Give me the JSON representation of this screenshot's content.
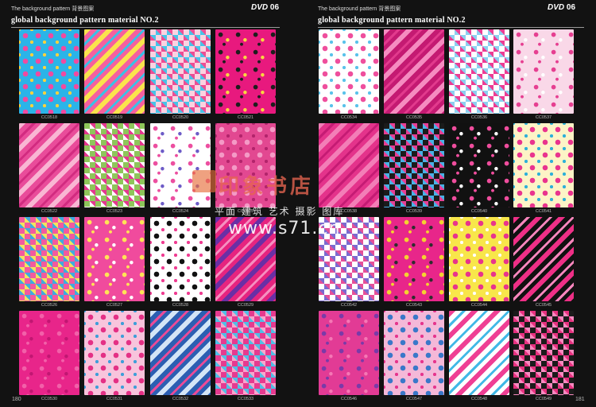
{
  "left_page": {
    "header": "The background pattern 背景图案",
    "dvd_label": "DVD",
    "dvd_number": "06",
    "title": "global background pattern material NO.2",
    "page_number": "180",
    "tiles": [
      {
        "code": "CC0518",
        "colors": [
          "#2bb4e8",
          "#f04aa0",
          "#ffd23c"
        ]
      },
      {
        "code": "CC0519",
        "colors": [
          "#f5609e",
          "#fbe34c",
          "#3ac0e6"
        ]
      },
      {
        "code": "CC0520",
        "colors": [
          "#fbd2e0",
          "#ee4d93",
          "#46c4e8"
        ]
      },
      {
        "code": "CC0521",
        "colors": [
          "#e8197e",
          "#1d1d1d",
          "#f8d840"
        ]
      },
      {
        "code": "CC0522",
        "colors": [
          "#e94c9a",
          "#f9b6d3",
          "#d22b80"
        ]
      },
      {
        "code": "CC0523",
        "colors": [
          "#8ec65a",
          "#e4378f",
          "#ffffff"
        ]
      },
      {
        "code": "CC0524",
        "colors": [
          "#ffffff",
          "#ec4fa0",
          "#6d5bc7"
        ]
      },
      {
        "code": "CC0525",
        "colors": [
          "#e24891",
          "#f49ac6",
          "#b3246c"
        ]
      },
      {
        "code": "CC0526",
        "colors": [
          "#f25a9f",
          "#3fa9e0",
          "#f4e25e"
        ]
      },
      {
        "code": "CC0527",
        "colors": [
          "#f04b9d",
          "#ffe455",
          "#ffffff"
        ]
      },
      {
        "code": "CC0528",
        "colors": [
          "#ffffff",
          "#111111",
          "#ef3d92"
        ]
      },
      {
        "code": "CC0529",
        "colors": [
          "#e6247f",
          "#6a2fa5",
          "#f590c0"
        ]
      },
      {
        "code": "CC0530",
        "colors": [
          "#e8258a",
          "#f260a9",
          "#c11672"
        ]
      },
      {
        "code": "CC0531",
        "colors": [
          "#f8c4dc",
          "#e43085",
          "#3f9fd8"
        ]
      },
      {
        "code": "CC0532",
        "colors": [
          "#2c5fb2",
          "#d4e5f6",
          "#ec4a97"
        ]
      },
      {
        "code": "CC0533",
        "colors": [
          "#e63a8f",
          "#4fbfe6",
          "#f7a6cc"
        ]
      }
    ]
  },
  "right_page": {
    "header": "The background pattern 背景图案",
    "dvd_label": "DVD",
    "dvd_number": "06",
    "title": "global background pattern material NO.2",
    "page_number": "181",
    "tiles": [
      {
        "code": "CC0534",
        "colors": [
          "#ffffff",
          "#ef4f9d",
          "#5bc3ea"
        ]
      },
      {
        "code": "CC0535",
        "colors": [
          "#c41a72",
          "#f58cc0",
          "#e23a8d"
        ]
      },
      {
        "code": "CC0536",
        "colors": [
          "#ffffff",
          "#ed3c93",
          "#8bd1f0"
        ]
      },
      {
        "code": "CC0537",
        "colors": [
          "#f9d8e8",
          "#e63f91",
          "#ffffff"
        ]
      },
      {
        "code": "CC0538",
        "colors": [
          "#e4338b",
          "#f37eb7",
          "#c51b74"
        ]
      },
      {
        "code": "CC0539",
        "colors": [
          "#1b1b1b",
          "#e83e93",
          "#47b2e6"
        ]
      },
      {
        "code": "CC0540",
        "colors": [
          "#111111",
          "#ef4d9d",
          "#ffffff"
        ]
      },
      {
        "code": "CC0541",
        "colors": [
          "#fdf4c6",
          "#e9348e",
          "#2fb1d8"
        ]
      },
      {
        "code": "CC0542",
        "colors": [
          "#ffffff",
          "#e65098",
          "#7a6bd0"
        ]
      },
      {
        "code": "CC0543",
        "colors": [
          "#e8268a",
          "#f4d230",
          "#2d2d2d"
        ]
      },
      {
        "code": "CC0544",
        "colors": [
          "#f8e64a",
          "#e8348c",
          "#ffffff"
        ]
      },
      {
        "code": "CC0545",
        "colors": [
          "#111111",
          "#ee2f86",
          "#f886bd"
        ]
      },
      {
        "code": "CC0546",
        "colors": [
          "#e23b95",
          "#7a3aa8",
          "#f577b5"
        ]
      },
      {
        "code": "CC0547",
        "colors": [
          "#f4b8d8",
          "#3a78c9",
          "#e6358d"
        ]
      },
      {
        "code": "CC0548",
        "colors": [
          "#ffffff",
          "#ef3f94",
          "#41b9e6"
        ]
      },
      {
        "code": "CC0549",
        "colors": [
          "#1b1b1b",
          "#e7317f",
          "#f88ac0"
        ]
      }
    ]
  },
  "watermark": {
    "brand": "印象书店",
    "tagline": "平面 建筑 艺术 摄影 图库",
    "url": "www.s71.cn"
  }
}
